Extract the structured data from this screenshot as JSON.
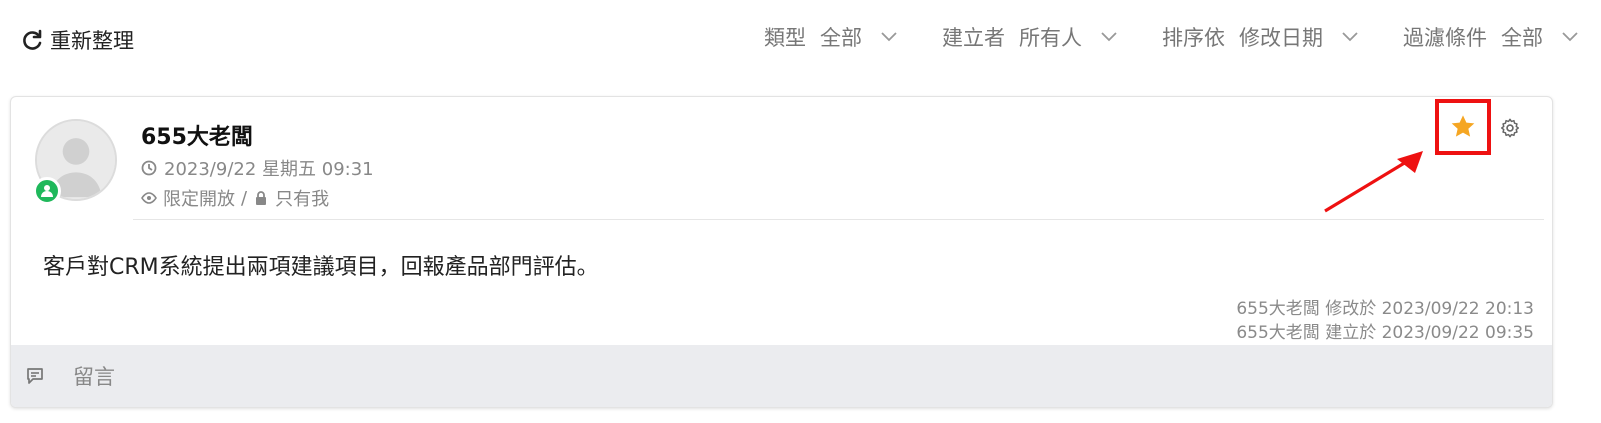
{
  "toolbar": {
    "refresh_label": "重新整理",
    "refresh_icon": "refresh-icon",
    "filters": [
      {
        "label": "類型",
        "value": "全部"
      },
      {
        "label": "建立者",
        "value": "所有人"
      },
      {
        "label": "排序依",
        "value": "修改日期"
      },
      {
        "label": "過濾條件",
        "value": "全部"
      }
    ]
  },
  "post": {
    "author": "655大老闆",
    "timestamp": "2023/9/22 星期五 09:31",
    "visibility": "限定開放",
    "visibility_sep": "/",
    "privacy": "只有我",
    "content": "客戶對CRM系統提出兩項建議項目，回報產品部門評估。",
    "modified_line": "655大老闆 修改於 2023/09/22 20:13",
    "created_line": "655大老闆 建立於 2023/09/22 09:35",
    "comment_label": "留言"
  },
  "colors": {
    "star": "#f5a623",
    "highlight": "#ee1111",
    "status_online": "#1fb85b",
    "footer_bg": "#ebecef"
  }
}
